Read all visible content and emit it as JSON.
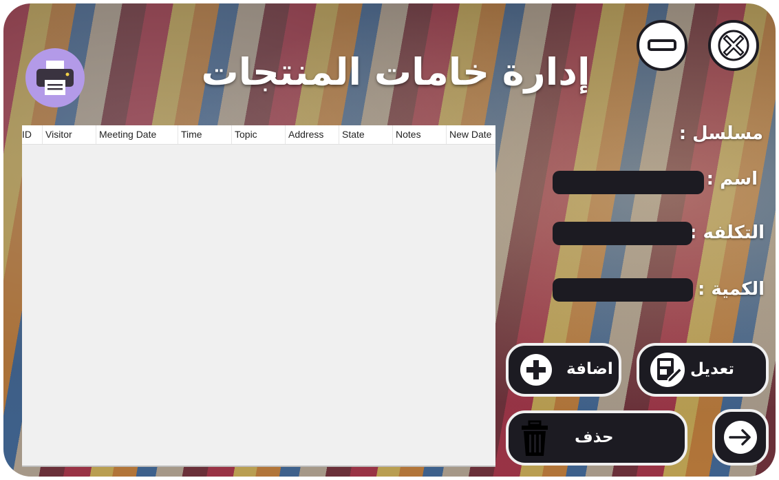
{
  "window": {
    "title": "إدارة خامات المنتجات"
  },
  "toolbar": {
    "print_icon": "printer-icon",
    "minimize_icon": "minimize-icon",
    "close_icon": "close-icon"
  },
  "table": {
    "columns": [
      "ID",
      "Visitor",
      "Meeting Date",
      "Time",
      "Topic",
      "Address",
      "State",
      "Notes",
      "New Date"
    ],
    "rows": []
  },
  "form": {
    "serial_label": "مسلسل :",
    "name_label": "اسم :",
    "name_value": "",
    "cost_label": "التكلفه :",
    "cost_value": "",
    "quantity_label": "الكمية :",
    "quantity_value": ""
  },
  "actions": {
    "add_label": "اضافة",
    "edit_label": "تعديل",
    "delete_label": "حذف",
    "next_icon": "arrow-right-icon"
  },
  "colors": {
    "dark": "#1c1b22",
    "print_button": "#b39ae8",
    "table_bg": "#f0f0f0"
  }
}
